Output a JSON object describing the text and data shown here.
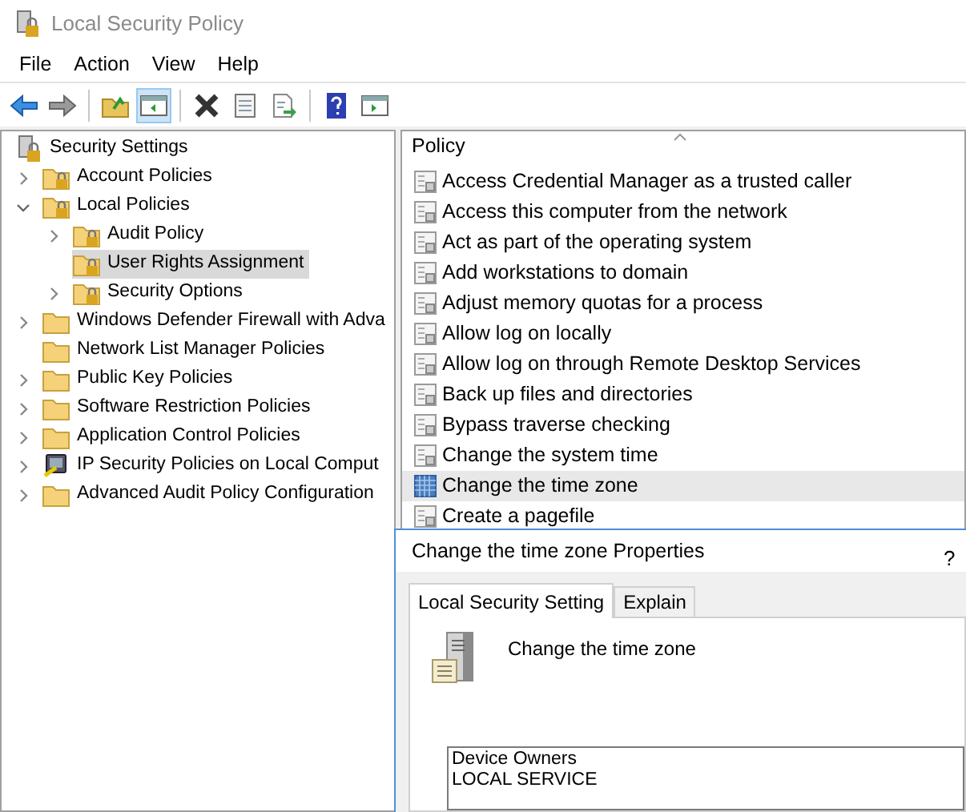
{
  "window": {
    "title": "Local Security Policy"
  },
  "menu": [
    "File",
    "Action",
    "View",
    "Help"
  ],
  "toolbar": [
    {
      "kind": "back",
      "pressed": false
    },
    {
      "kind": "forward",
      "pressed": false
    },
    {
      "kind": "separator"
    },
    {
      "kind": "up",
      "pressed": false
    },
    {
      "kind": "pane",
      "pressed": true
    },
    {
      "kind": "separator"
    },
    {
      "kind": "delete",
      "pressed": false
    },
    {
      "kind": "properties",
      "pressed": false
    },
    {
      "kind": "export",
      "pressed": false
    },
    {
      "kind": "separator"
    },
    {
      "kind": "help",
      "pressed": false
    },
    {
      "kind": "console",
      "pressed": false
    }
  ],
  "tree": [
    {
      "label": "Security Settings",
      "kind": "root",
      "selected": false,
      "children": [
        {
          "label": "Account Policies",
          "kind": "lock",
          "expanded": false,
          "selected": false
        },
        {
          "label": "Local Policies",
          "kind": "lock",
          "expanded": true,
          "selected": false,
          "children": [
            {
              "label": "Audit Policy",
              "kind": "lock",
              "expanded": false,
              "selected": false
            },
            {
              "label": "User Rights Assignment",
              "kind": "lock",
              "selected": true
            },
            {
              "label": "Security Options",
              "kind": "lock",
              "expanded": false,
              "selected": false
            }
          ]
        },
        {
          "label": "Windows Defender Firewall with Adva",
          "kind": "folder",
          "expanded": false,
          "selected": false
        },
        {
          "label": "Network List Manager Policies",
          "kind": "folder",
          "selected": false
        },
        {
          "label": "Public Key Policies",
          "kind": "folder",
          "expanded": false,
          "selected": false
        },
        {
          "label": "Software Restriction Policies",
          "kind": "folder",
          "expanded": false,
          "selected": false
        },
        {
          "label": "Application Control Policies",
          "kind": "folder",
          "expanded": false,
          "selected": false
        },
        {
          "label": "IP Security Policies on Local Comput",
          "kind": "ipsec",
          "expanded": false,
          "selected": false
        },
        {
          "label": "Advanced Audit Policy Configuration",
          "kind": "folder",
          "expanded": false,
          "selected": false
        }
      ]
    }
  ],
  "policy_list": {
    "column": "Policy",
    "rows": [
      {
        "label": "Access Credential Manager as a trusted caller",
        "selected": false
      },
      {
        "label": "Access this computer from the network",
        "selected": false
      },
      {
        "label": "Act as part of the operating system",
        "selected": false
      },
      {
        "label": "Add workstations to domain",
        "selected": false
      },
      {
        "label": "Adjust memory quotas for a process",
        "selected": false
      },
      {
        "label": "Allow log on locally",
        "selected": false
      },
      {
        "label": "Allow log on through Remote Desktop Services",
        "selected": false
      },
      {
        "label": "Back up files and directories",
        "selected": false
      },
      {
        "label": "Bypass traverse checking",
        "selected": false
      },
      {
        "label": "Change the system time",
        "selected": false
      },
      {
        "label": "Change the time zone",
        "selected": true
      },
      {
        "label": "Create a pagefile",
        "selected": false
      }
    ]
  },
  "dialog": {
    "title": "Change the time zone Properties",
    "help": "?",
    "tabs": [
      {
        "label": "Local Security Setting",
        "selected": true
      },
      {
        "label": "Explain",
        "selected": false
      }
    ],
    "policy_name": "Change the time zone",
    "accounts": [
      "Device Owners",
      "LOCAL SERVICE"
    ]
  }
}
